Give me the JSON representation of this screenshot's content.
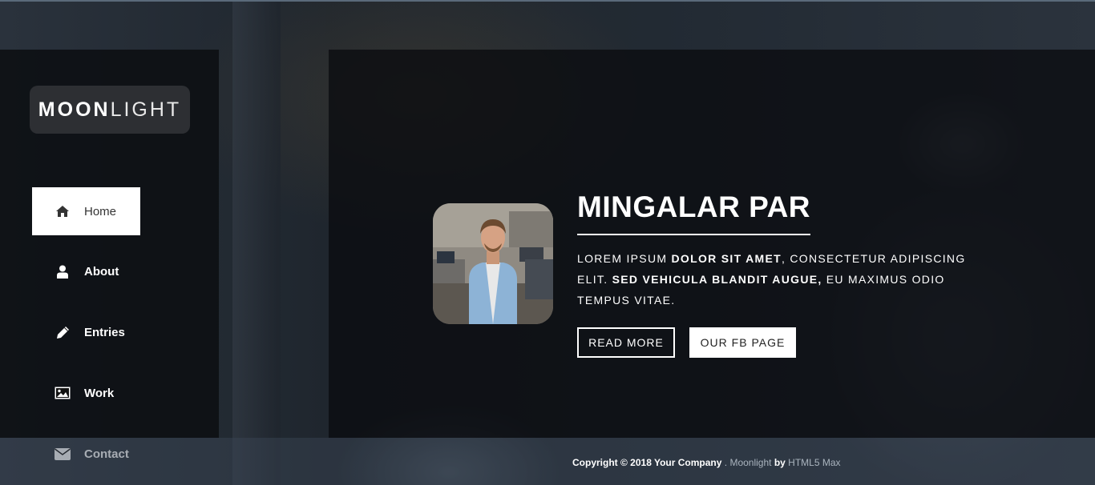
{
  "brand": {
    "bold": "MOON",
    "light": "LIGHT"
  },
  "nav": {
    "items": [
      {
        "label": "Home",
        "icon": "home-icon",
        "active": true
      },
      {
        "label": "About",
        "icon": "user-icon",
        "active": false
      },
      {
        "label": "Entries",
        "icon": "pencil-icon",
        "active": false
      },
      {
        "label": "Work",
        "icon": "image-icon",
        "active": false
      },
      {
        "label": "Contact",
        "icon": "envelope-icon",
        "active": false
      }
    ]
  },
  "hero": {
    "title": "MINGALAR PAR",
    "description": {
      "part1": "Lorem ipsum ",
      "bold1": "dolor sit amet",
      "part2": ", consectetur adipiscing elit. ",
      "bold2": "Sed vehicula blandit augue,",
      "part3": " eu maximus odio tempus vitae."
    },
    "buttons": {
      "read_more": "READ MORE",
      "fb_page": "OUR FB PAGE"
    }
  },
  "footer": {
    "copyright": "Copyright © 2018 Your Company",
    "separator": " . ",
    "site": "Moonlight",
    "by": " by ",
    "author": "HTML5 Max"
  },
  "colors": {
    "panel": "#0a0c10",
    "logo_bg": "#2d2f33",
    "active_nav_bg": "#ffffff",
    "muted_link": "#aab4be"
  }
}
